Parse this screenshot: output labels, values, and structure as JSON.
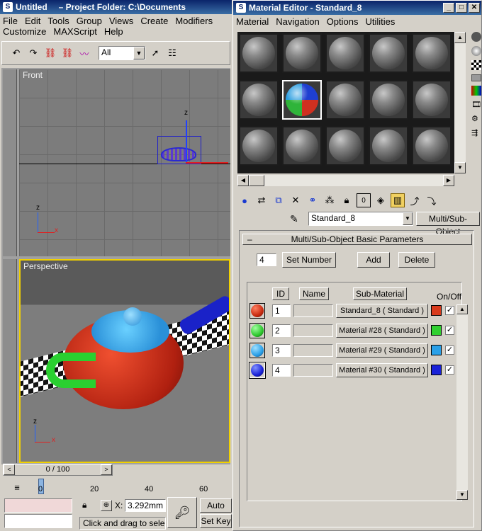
{
  "max_window": {
    "title": "Untitled",
    "project_folder": "– Project Folder: C:\\Documents",
    "menu": [
      "File",
      "Edit",
      "Tools",
      "Group",
      "Views",
      "Create",
      "Modifiers",
      "Customize",
      "MAXScript",
      "Help"
    ],
    "selection_filter": "All",
    "viewports": {
      "front_label": "Front",
      "perspective_label": "Perspective"
    },
    "axis_labels": {
      "z": "z",
      "x": "x"
    },
    "time_slider": "0 / 100",
    "track_ticks": [
      "0",
      "20",
      "40",
      "60"
    ],
    "coord_label": "X:",
    "coord_value": "3.292mm",
    "auto_key": "Auto Key",
    "set_key": "Set Key",
    "status_text": "Click and drag to select a"
  },
  "material_editor": {
    "title": "Material Editor - Standard_8",
    "menu": [
      "Material",
      "Navigation",
      "Options",
      "Utilities"
    ],
    "material_name": "Standard_8",
    "material_type": "Multi/Sub-Object",
    "rollout_title": "Multi/Sub-Object Basic Parameters",
    "count": "4",
    "set_number": "Set Number",
    "add": "Add",
    "delete": "Delete",
    "headers": {
      "id": "ID",
      "name": "Name",
      "sub": "Sub-Material",
      "onoff": "On/Off"
    },
    "rows": [
      {
        "id": "1",
        "sub": "Standard_8  ( Standard )",
        "color": "#d83a1c"
      },
      {
        "id": "2",
        "sub": "Material #28  ( Standard )",
        "color": "#30d030"
      },
      {
        "id": "3",
        "sub": "Material #29  ( Standard )",
        "color": "#2aa0e8"
      },
      {
        "id": "4",
        "sub": "Material #30  ( Standard )",
        "color": "#1a22d8"
      }
    ]
  }
}
